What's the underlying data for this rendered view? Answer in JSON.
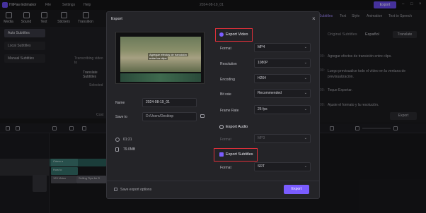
{
  "app": {
    "name": "HitPaw Edimakor",
    "menus": [
      "File",
      "Settings",
      "Help"
    ],
    "document_title": "2024-08-19_01",
    "export_label": "Export"
  },
  "toolbar": [
    "Media",
    "Sound",
    "Text",
    "Stickers",
    "Transition"
  ],
  "left_panel": {
    "items": [
      "Auto Subtitles",
      "Local Subtitles",
      "Manual Subtitles"
    ],
    "middle_text": [
      "Transcribing video to",
      "Translate Subtitles",
      "Selected",
      "Cost"
    ]
  },
  "right_panel": {
    "tabs": [
      "Subtitles",
      "Text",
      "Style",
      "Animation",
      "Text to Speech"
    ],
    "header": "Original Subtitles",
    "language": "Español",
    "translate": "Translate",
    "lines": [
      "Agregar efectos de transición entre clips.",
      "Luego previsualice todo el vídeo en la ventana de previsualización.",
      "Toque Exportar.",
      "Ajuste el formato y la resolución."
    ],
    "timestamps": [
      "00:",
      "00:",
      "00:",
      "00:"
    ],
    "export_label": "Export"
  },
  "timeline": {
    "clips": [
      "Cómo u",
      "How to",
      "123 Video",
      "Selling Tips for S"
    ]
  },
  "dialog": {
    "title": "Export",
    "preview_captions": [
      "Agregue efectos de transición",
      "entre los clips"
    ],
    "name_label": "Name",
    "name_value": "2024-08-19_01",
    "save_label": "Save to",
    "save_value": "D:/Users/Desktop",
    "duration": "01:21",
    "size": "79.0MB",
    "export_video_label": "Export Video",
    "video_fields": [
      {
        "label": "Format",
        "value": "MP4"
      },
      {
        "label": "Resolution",
        "value": "1080P"
      },
      {
        "label": "Encoding",
        "value": "H264"
      },
      {
        "label": "Bit rate",
        "value": "Recommended"
      },
      {
        "label": "Frame Rate",
        "value": "25 fps"
      }
    ],
    "export_audio_label": "Export Audio",
    "audio_format_label": "Format",
    "audio_format_value": "MP3",
    "export_subtitles_label": "Export Subtitles",
    "subtitle_format_label": "Format",
    "subtitle_format_value": "SRT",
    "save_options_label": "Save export options",
    "export_button": "Export",
    "accent_color": "#7a5cff",
    "highlight_color": "#e0303a"
  }
}
